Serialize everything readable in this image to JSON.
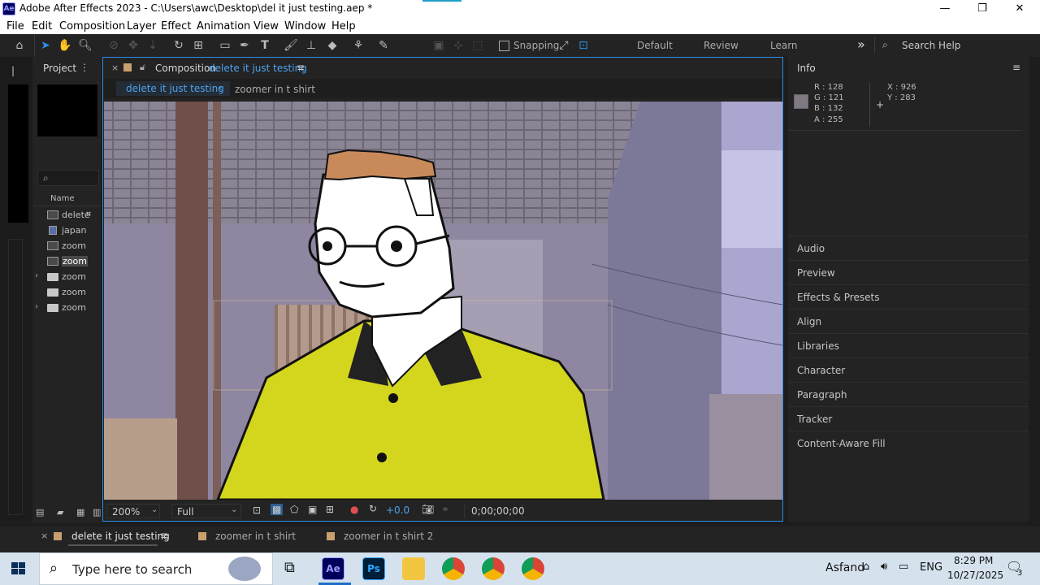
{
  "window": {
    "app_icon": "Ae",
    "title": "Adobe After Effects 2023 - C:\\Users\\awc\\Desktop\\del it just testing.aep *",
    "minimize_glyph": "—",
    "maximize_glyph": "❐",
    "close_glyph": "✕"
  },
  "menu": [
    "File",
    "Edit",
    "Composition",
    "Layer",
    "Effect",
    "Animation",
    "View",
    "Window",
    "Help"
  ],
  "toolbar": {
    "snapping_label": "Snapping",
    "workspaces": [
      "Default",
      "Review",
      "Learn"
    ],
    "more_glyph": "»",
    "search_placeholder": "Search Help"
  },
  "project": {
    "title": "Project",
    "column_name": "Name",
    "items": [
      "delete",
      "japan",
      "zoom",
      "zoom",
      "zoom",
      "zoom",
      "zoom"
    ]
  },
  "composition": {
    "tab_prefix": "Composition",
    "tab_name": "delete it just testing",
    "breadcrumb_active": "delete it just testing",
    "breadcrumb_next": "zoomer in t shirt",
    "zoom": "200%",
    "resolution": "Full",
    "exposure": "+0.0",
    "timecode": "0;00;00;00"
  },
  "info": {
    "title": "Info",
    "r": "R : 128",
    "g": "G : 121",
    "b": "B : 132",
    "a": "A : 255",
    "x": "X : 926",
    "y": "Y : 283",
    "swatch_color": "#807984"
  },
  "right_panels": [
    "Audio",
    "Preview",
    "Effects & Presets",
    "Align",
    "Libraries",
    "Character",
    "Paragraph",
    "Tracker",
    "Content-Aware Fill"
  ],
  "timeline_tabs": [
    "delete it just testing",
    "zoomer in t shirt",
    "zoomer in t shirt 2"
  ],
  "taskbar": {
    "search_placeholder": "Type here to search",
    "location": "Asfand",
    "language": "ENG",
    "time": "8:29 PM",
    "date": "10/27/2025",
    "notification_count": "3"
  }
}
